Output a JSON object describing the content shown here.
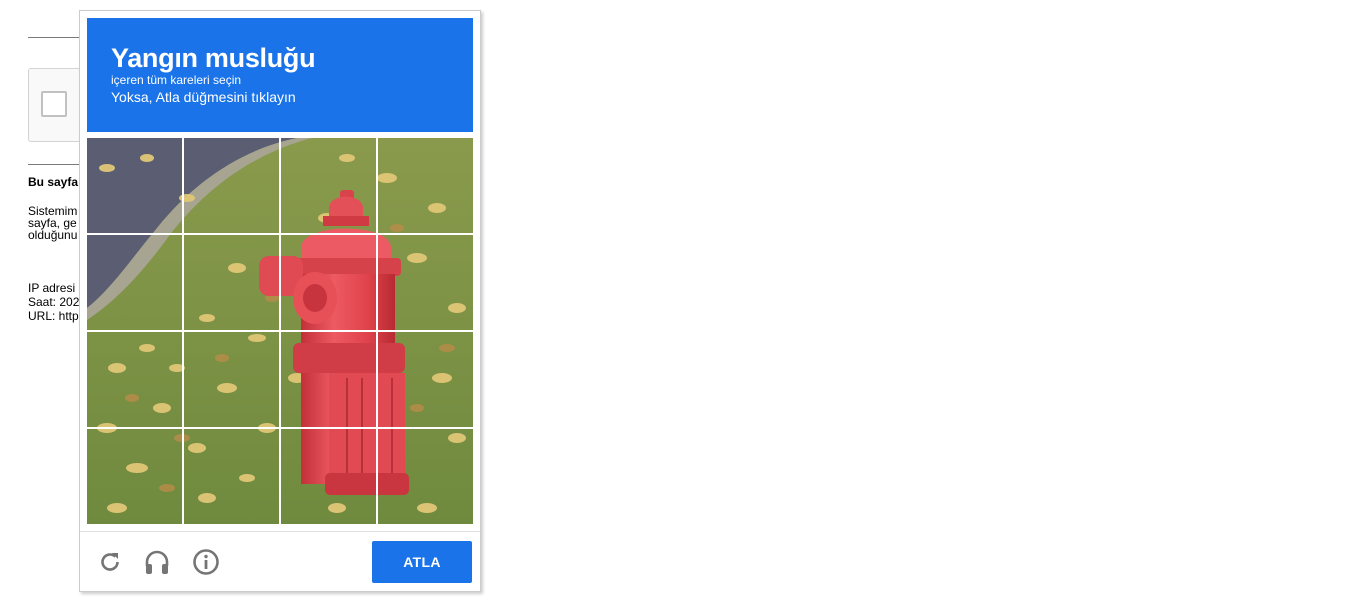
{
  "background_page": {
    "heading": "Bu sayfa",
    "paragraph": [
      "Sistemim",
      "sayfa, ge",
      "olduğunu"
    ],
    "info": [
      "IP adresi",
      "Saat: 202",
      "URL: http"
    ]
  },
  "captcha": {
    "title": "Yangın musluğu",
    "subtitle": "içeren tüm kareleri seçin",
    "hint": "Yoksa, Atla düğmesini tıklayın",
    "skip_label": "ATLA",
    "grid": {
      "rows": 4,
      "cols": 4
    },
    "icons": [
      "reload-icon",
      "audio-headphones-icon",
      "info-icon"
    ],
    "colors": {
      "accent": "#1a73e8",
      "icon": "#757575"
    }
  }
}
